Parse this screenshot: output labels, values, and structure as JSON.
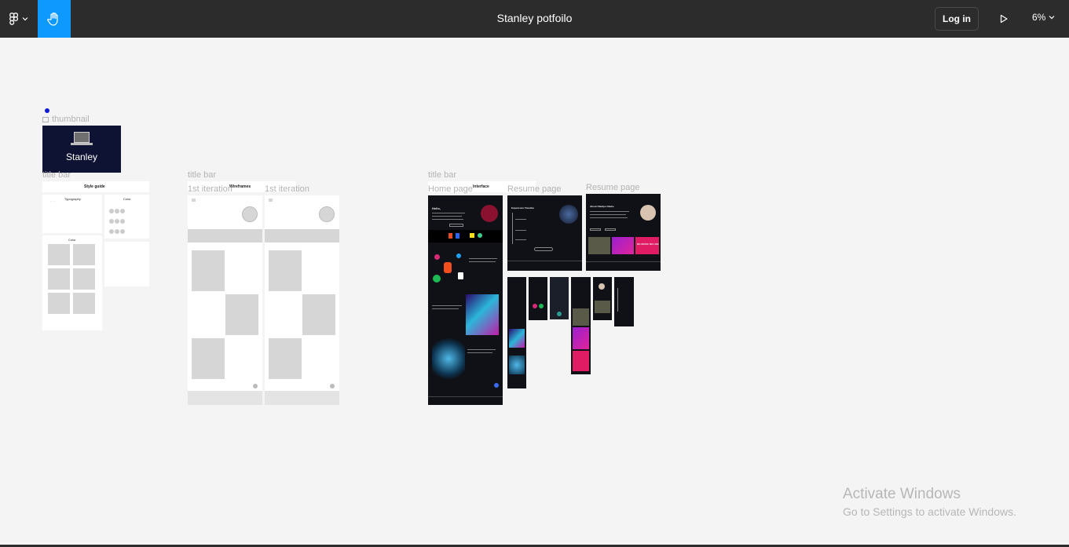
{
  "toolbar": {
    "file_title": "Stanley potfoilo",
    "login_label": "Log in",
    "zoom_label": "6%",
    "icons": [
      "figma-logo-icon",
      "chevron-down-icon",
      "hand-tool-icon",
      "play-icon"
    ],
    "accent_color": "#0d99ff",
    "bar_color": "#2c2c2c"
  },
  "canvas": {
    "thumbnail": {
      "label": "thumbnail",
      "title": "Stanley"
    },
    "frames": {
      "style_guide": {
        "label": "title bar",
        "header": "Style guide",
        "typography": "Typography",
        "color_a": "Color",
        "color_b": "Color"
      },
      "wireframes": {
        "label": "title bar",
        "header": "Wireframes",
        "iteration_1": "1st iteration",
        "iteration_2": "1st iteration"
      },
      "interface": {
        "label": "title bar",
        "header": "Interface",
        "home_page": "Home page",
        "resume_page_1": "Resume page",
        "resume_page_2": "Resume page",
        "home_hello": "Hello,",
        "resume_heading": "Experience Timeline",
        "about_heading": "About Oladipo Okeke",
        "music_tag": "NO MUSIC NO LIFE"
      }
    }
  },
  "watermark": {
    "title": "Activate Windows",
    "subtitle": "Go to Settings to activate Windows."
  }
}
